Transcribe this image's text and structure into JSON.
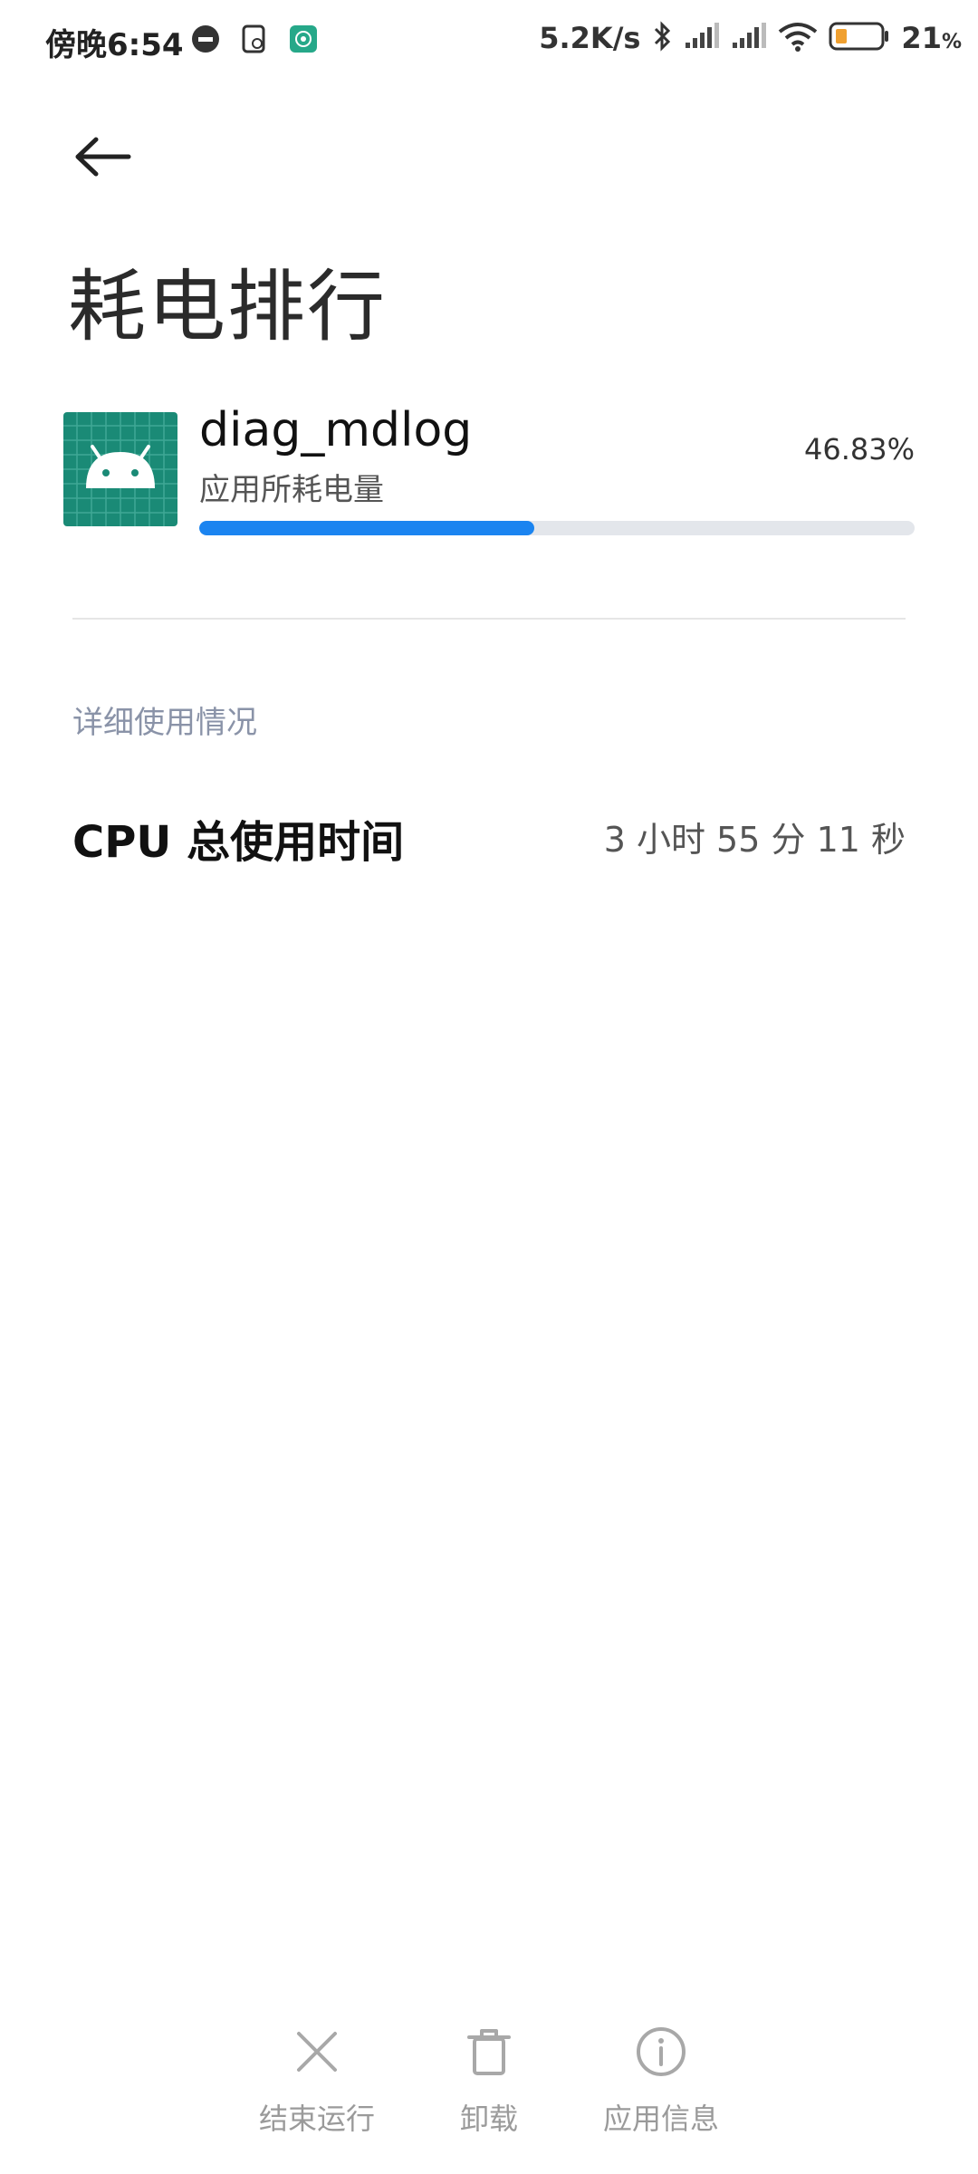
{
  "status_bar": {
    "time": "傍晚6:54",
    "net_speed": "5.2K/s",
    "battery": "21",
    "battery_unit": "%",
    "icons": [
      "dnd-icon",
      "app-notif-icon",
      "hotspot-icon",
      "bluetooth-icon",
      "signal-icon",
      "signal-icon",
      "wifi-icon",
      "battery-icon"
    ]
  },
  "header": {
    "back": "arrow-left-icon",
    "title": "耗电排行"
  },
  "app": {
    "name": "diag_mdlog",
    "subtitle": "应用所耗电量",
    "percent_text": "46.83%",
    "percent": 0.4683,
    "icon": "android-icon",
    "icon_color": "#1a8a76",
    "bar_color": "#1b84f0"
  },
  "details": {
    "section_label": "详细使用情况",
    "cpu_label": "CPU 总使用时间",
    "cpu_value": "3 小时 55 分 11 秒"
  },
  "actions": [
    {
      "label": "结束运行",
      "icon": "close-icon"
    },
    {
      "label": "卸载",
      "icon": "trash-icon"
    },
    {
      "label": "应用信息",
      "icon": "info-icon"
    }
  ]
}
